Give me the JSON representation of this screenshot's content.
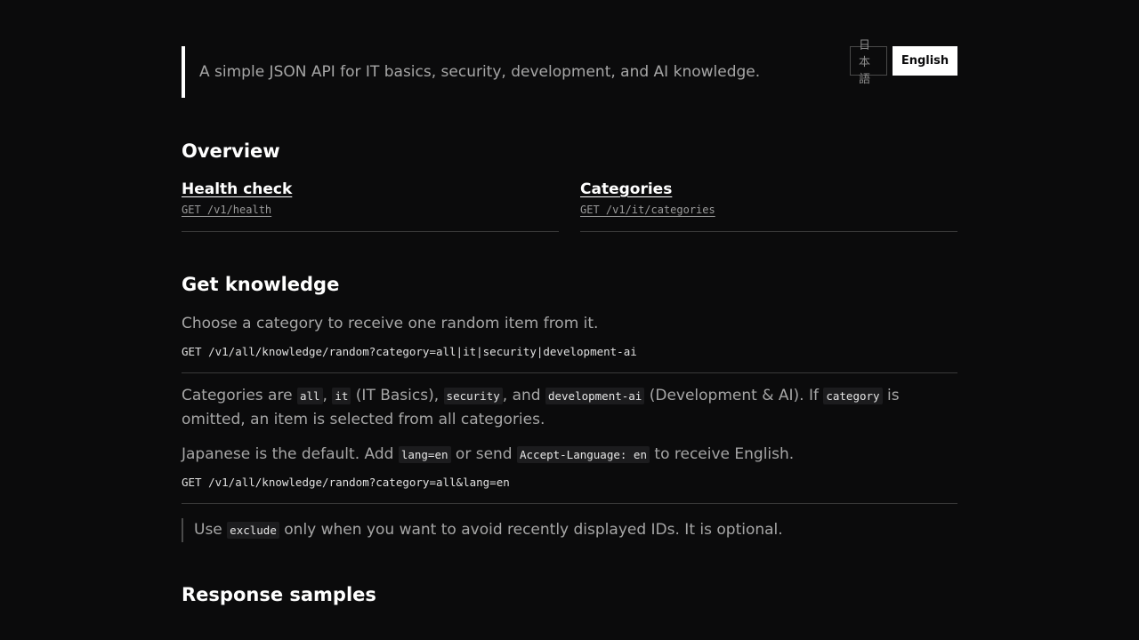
{
  "header": {
    "tagline": "A simple JSON API for IT basics, security, development, and AI knowledge.",
    "lang_ja": "日本語",
    "lang_en": "English"
  },
  "overview": {
    "title": "Overview",
    "cards": [
      {
        "title": "Health check",
        "path": "GET /v1/health"
      },
      {
        "title": "Categories",
        "path": "GET /v1/it/categories"
      }
    ]
  },
  "knowledge": {
    "title": "Get knowledge",
    "intro": "Choose a category to receive one random item from it.",
    "endpoint1": "GET /v1/all/knowledge/random?category=all|it|security|development-ai",
    "cats": {
      "t1": "Categories are ",
      "c1": "all",
      "t2": ", ",
      "c2": "it",
      "t3": " (IT Basics), ",
      "c3": "security",
      "t4": ", and ",
      "c4": "development-ai",
      "t5": " (Development & AI). If ",
      "c5": "category",
      "t6": " is omitted, an item is selected from all categories."
    },
    "lang": {
      "t1": "Japanese is the default. Add ",
      "c1": "lang=en",
      "t2": " or send ",
      "c2": "Accept-Language: en",
      "t3": " to receive English."
    },
    "endpoint2": "GET /v1/all/knowledge/random?category=all&lang=en",
    "note": {
      "t1": "Use ",
      "c1": "exclude",
      "t2": " only when you want to avoid recently displayed IDs. It is optional."
    }
  },
  "response": {
    "title": "Response samples"
  }
}
